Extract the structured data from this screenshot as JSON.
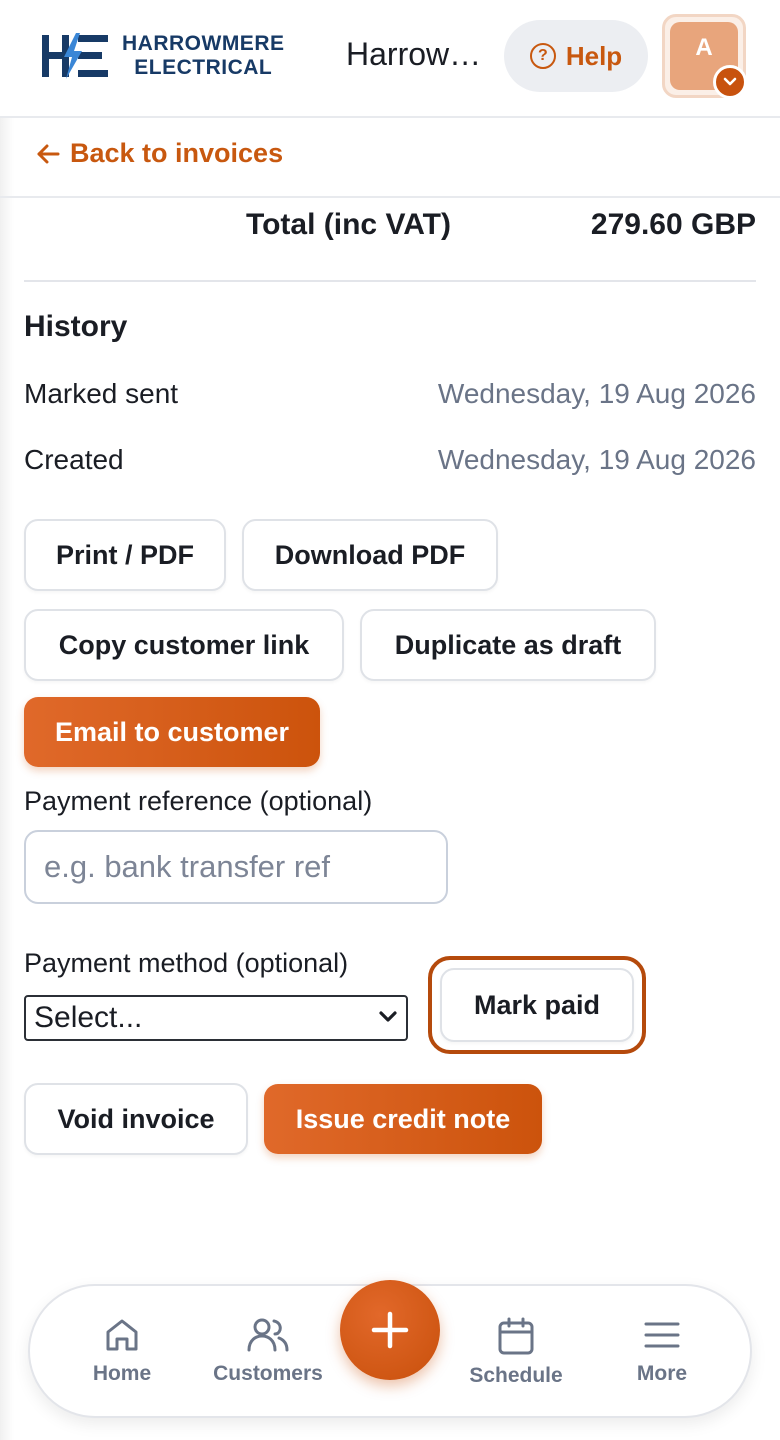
{
  "header": {
    "brand_line1": "HARROWMERE",
    "brand_line2": "ELECTRICAL",
    "title": "Harrowmere Electrical",
    "help_label": "Help",
    "avatar_initial": "A"
  },
  "nav": {
    "back_label": "Back to invoices"
  },
  "invoice": {
    "total_label": "Total (inc VAT)",
    "total_value": "279.60 GBP"
  },
  "history": {
    "title": "History",
    "items": [
      {
        "label": "Marked sent",
        "date": "Wednesday, 19 Aug 2026"
      },
      {
        "label": "Created",
        "date": "Wednesday, 19 Aug 2026"
      }
    ]
  },
  "actions": {
    "print_pdf": "Print / PDF",
    "download_pdf": "Download PDF",
    "copy_link": "Copy customer link",
    "duplicate": "Duplicate as draft",
    "email": "Email to customer"
  },
  "payment": {
    "reference_label": "Payment reference (optional)",
    "reference_placeholder": "e.g. bank transfer ref",
    "method_label": "Payment method (optional)",
    "method_selected": "Select...",
    "mark_paid": "Mark paid"
  },
  "danger": {
    "void": "Void invoice",
    "credit_note": "Issue credit note"
  },
  "bottom_nav": {
    "home": "Home",
    "customers": "Customers",
    "schedule": "Schedule",
    "more": "More"
  },
  "colors": {
    "accent": "#c8580f",
    "brand_navy": "#173a66",
    "muted_text": "#6a7487"
  }
}
